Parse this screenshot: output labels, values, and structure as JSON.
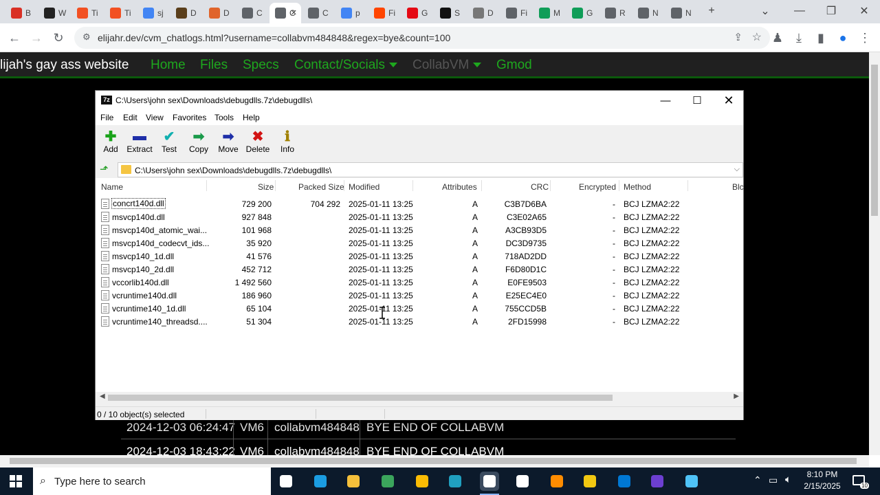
{
  "browser": {
    "tabs": [
      {
        "label": "B",
        "color": "#d93025"
      },
      {
        "label": "W",
        "color": "#222222"
      },
      {
        "label": "Ti",
        "color": "#f25022"
      },
      {
        "label": "Ti",
        "color": "#f25022"
      },
      {
        "label": "sj",
        "color": "#4285f4"
      },
      {
        "label": "D",
        "color": "#5a3e1b"
      },
      {
        "label": "D",
        "color": "#e0642b"
      },
      {
        "label": "C",
        "color": "#5f6368"
      },
      {
        "label": "C",
        "color": "#5f6368"
      },
      {
        "label": "C",
        "color": "#5f6368"
      },
      {
        "label": "p",
        "color": "#4285f4"
      },
      {
        "label": "Fi",
        "color": "#ff4500"
      },
      {
        "label": "G",
        "color": "#e50914"
      },
      {
        "label": "S",
        "color": "#111111"
      },
      {
        "label": "D",
        "color": "#777777"
      },
      {
        "label": "Fi",
        "color": "#5f6368"
      },
      {
        "label": "M",
        "color": "#0f9d58"
      },
      {
        "label": "G",
        "color": "#0f9d58"
      },
      {
        "label": "R",
        "color": "#5f6368"
      },
      {
        "label": "N",
        "color": "#5f6368"
      },
      {
        "label": "N",
        "color": "#5f6368"
      }
    ],
    "url": "elijahr.dev/cvm_chatlogs.html?username=collabvm484848&regex=bye&count=100"
  },
  "site": {
    "title": "lijah's gay ass website",
    "nav": [
      "Home",
      "Files",
      "Specs",
      "Contact/Socials",
      "CollabVM",
      "Gmod"
    ],
    "log_rows": [
      {
        "time": "2024-12-03 06:24:47",
        "vm": "VM6",
        "user": "collabvm484848",
        "msg": "BYE END OF COLLABVM"
      },
      {
        "time": "2024-12-03 18:43:22",
        "vm": "VM6",
        "user": "collabvm484848",
        "msg": "BYE END OF COLLABVM"
      }
    ]
  },
  "sevenzip": {
    "title": "C:\\Users\\john sex\\Downloads\\debugdlls.7z\\debugdlls\\",
    "menu": [
      "File",
      "Edit",
      "View",
      "Favorites",
      "Tools",
      "Help"
    ],
    "toolbar": [
      {
        "label": "Add",
        "icon": "plus-icon",
        "glyph": "✚",
        "color": "#1aa31a"
      },
      {
        "label": "Extract",
        "icon": "minus-icon",
        "glyph": "▬",
        "color": "#1f2fa8"
      },
      {
        "label": "Test",
        "icon": "check-icon",
        "glyph": "✔",
        "color": "#12b0b0"
      },
      {
        "label": "Copy",
        "icon": "arrow-right-icon",
        "glyph": "➡",
        "color": "#1a9a4a"
      },
      {
        "label": "Move",
        "icon": "arrow-right-icon",
        "glyph": "➡",
        "color": "#1f2fa8"
      },
      {
        "label": "Delete",
        "icon": "x-icon",
        "glyph": "✖",
        "color": "#d21414"
      },
      {
        "label": "Info",
        "icon": "info-icon",
        "glyph": "ℹ",
        "color": "#a08000"
      }
    ],
    "path": "C:\\Users\\john sex\\Downloads\\debugdlls.7z\\debugdlls\\",
    "columns": [
      "Name",
      "Size",
      "Packed Size",
      "Modified",
      "Attributes",
      "CRC",
      "Encrypted",
      "Method",
      "Blc"
    ],
    "files": [
      {
        "name": "concrt140d.dll",
        "size": "729 200",
        "packed": "704 292",
        "modified": "2025-01-11 13:25",
        "attr": "A",
        "crc": "C3B7D6BA",
        "enc": "-",
        "method": "BCJ LZMA2:22"
      },
      {
        "name": "msvcp140d.dll",
        "size": "927 848",
        "packed": "",
        "modified": "2025-01-11 13:25",
        "attr": "A",
        "crc": "C3E02A65",
        "enc": "-",
        "method": "BCJ LZMA2:22"
      },
      {
        "name": "msvcp140d_atomic_wai...",
        "size": "101 968",
        "packed": "",
        "modified": "2025-01-11 13:25",
        "attr": "A",
        "crc": "A3CB93D5",
        "enc": "-",
        "method": "BCJ LZMA2:22"
      },
      {
        "name": "msvcp140d_codecvt_ids...",
        "size": "35 920",
        "packed": "",
        "modified": "2025-01-11 13:25",
        "attr": "A",
        "crc": "DC3D9735",
        "enc": "-",
        "method": "BCJ LZMA2:22"
      },
      {
        "name": "msvcp140_1d.dll",
        "size": "41 576",
        "packed": "",
        "modified": "2025-01-11 13:25",
        "attr": "A",
        "crc": "718AD2DD",
        "enc": "-",
        "method": "BCJ LZMA2:22"
      },
      {
        "name": "msvcp140_2d.dll",
        "size": "452 712",
        "packed": "",
        "modified": "2025-01-11 13:25",
        "attr": "A",
        "crc": "F6D80D1C",
        "enc": "-",
        "method": "BCJ LZMA2:22"
      },
      {
        "name": "vccorlib140d.dll",
        "size": "1 492 560",
        "packed": "",
        "modified": "2025-01-11 13:25",
        "attr": "A",
        "crc": "E0FE9503",
        "enc": "-",
        "method": "BCJ LZMA2:22"
      },
      {
        "name": "vcruntime140d.dll",
        "size": "186 960",
        "packed": "",
        "modified": "2025-01-11 13:25",
        "attr": "A",
        "crc": "E25EC4E0",
        "enc": "-",
        "method": "BCJ LZMA2:22"
      },
      {
        "name": "vcruntime140_1d.dll",
        "size": "65 104",
        "packed": "",
        "modified": "2025-01-11 13:25",
        "attr": "A",
        "crc": "755CCD5B",
        "enc": "-",
        "method": "BCJ LZMA2:22"
      },
      {
        "name": "vcruntime140_threadsd....",
        "size": "51 304",
        "packed": "",
        "modified": "2025-01-11 13:25",
        "attr": "A",
        "crc": "2FD15998",
        "enc": "-",
        "method": "BCJ LZMA2:22"
      }
    ],
    "status": "0 / 10 object(s) selected"
  },
  "taskbar": {
    "search_placeholder": "Type here to search",
    "apps": [
      {
        "name": "task-view",
        "color": "#ffffff"
      },
      {
        "name": "edge",
        "color": "#1b9de2"
      },
      {
        "name": "file-explorer",
        "color": "#f5c03b"
      },
      {
        "name": "app-green",
        "color": "#3ba55c"
      },
      {
        "name": "chrome",
        "color": "#fbbc04"
      },
      {
        "name": "app-teal",
        "color": "#20a0c0"
      },
      {
        "name": "7zip",
        "color": "#ffffff"
      },
      {
        "name": "defender",
        "color": "#ffffff"
      },
      {
        "name": "app-orange",
        "color": "#ff8c00"
      },
      {
        "name": "app-yellow",
        "color": "#f2c811"
      },
      {
        "name": "app-blue",
        "color": "#0078d4"
      },
      {
        "name": "app-purple",
        "color": "#6c3fd1"
      },
      {
        "name": "app-lightblue",
        "color": "#4fc3f7"
      }
    ],
    "time": "8:10 PM",
    "date": "2/15/2025",
    "notif_count": "10"
  }
}
